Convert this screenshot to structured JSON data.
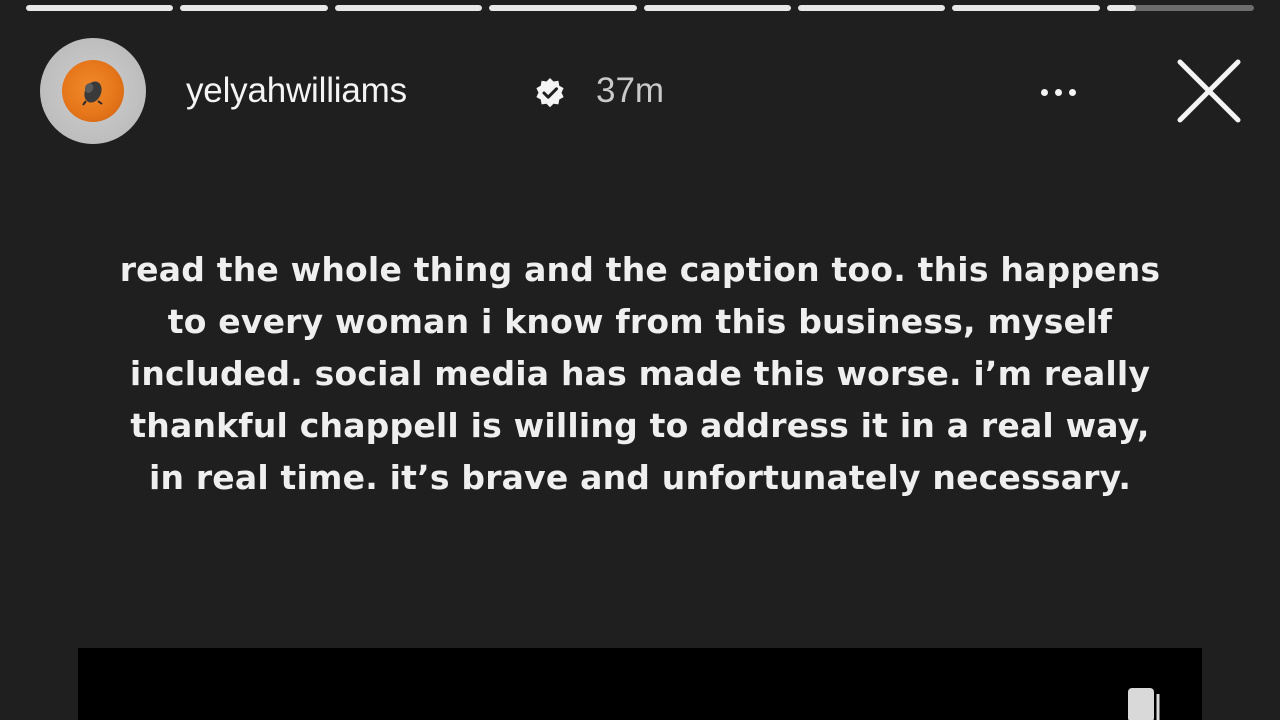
{
  "story": {
    "progress": [
      1,
      1,
      1,
      1,
      1,
      1,
      1,
      0.2
    ],
    "user": {
      "username": "yelyahwilliams",
      "verified": true,
      "timestamp": "37m",
      "avatar_icon": "avatar-icon"
    },
    "actions": {
      "more_icon": "more-options-icon",
      "close_icon": "close-icon"
    },
    "caption_lines": [
      "read the whole thing and the caption too. this happens",
      "to every woman i know from this business, myself",
      "included. social media has made this worse. i’m really",
      "thankful chappell is willing to address it in a real way,",
      "in real time. it’s brave and unfortunately necessary."
    ],
    "embedded_post_icon": "multi-post-icon"
  },
  "colors": {
    "background": "#1f1f1f",
    "text": "#efefef",
    "avatar_accent": "#e6761a"
  }
}
